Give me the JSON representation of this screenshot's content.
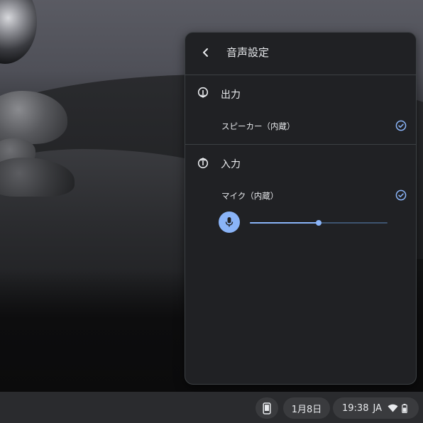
{
  "panel": {
    "title": "音声設定",
    "output": {
      "heading": "出力",
      "device": "スピーカー（内蔵）",
      "selected": true
    },
    "input": {
      "heading": "入力",
      "device": "マイク（内蔵）",
      "selected": true,
      "gain_percent": 50
    }
  },
  "shelf": {
    "date": "1月8日",
    "time": "19:38",
    "ime": "JA"
  },
  "colors": {
    "accent": "#8ab4f8",
    "panel_bg": "#202124",
    "shelf_bg": "#2a2b2e"
  },
  "icons": {
    "back": "chevron-left-icon",
    "output": "output-icon",
    "input": "input-icon",
    "check": "check-circle-icon",
    "mic": "microphone-icon",
    "phone": "phone-hub-icon",
    "wifi": "wifi-icon",
    "battery": "battery-icon"
  }
}
